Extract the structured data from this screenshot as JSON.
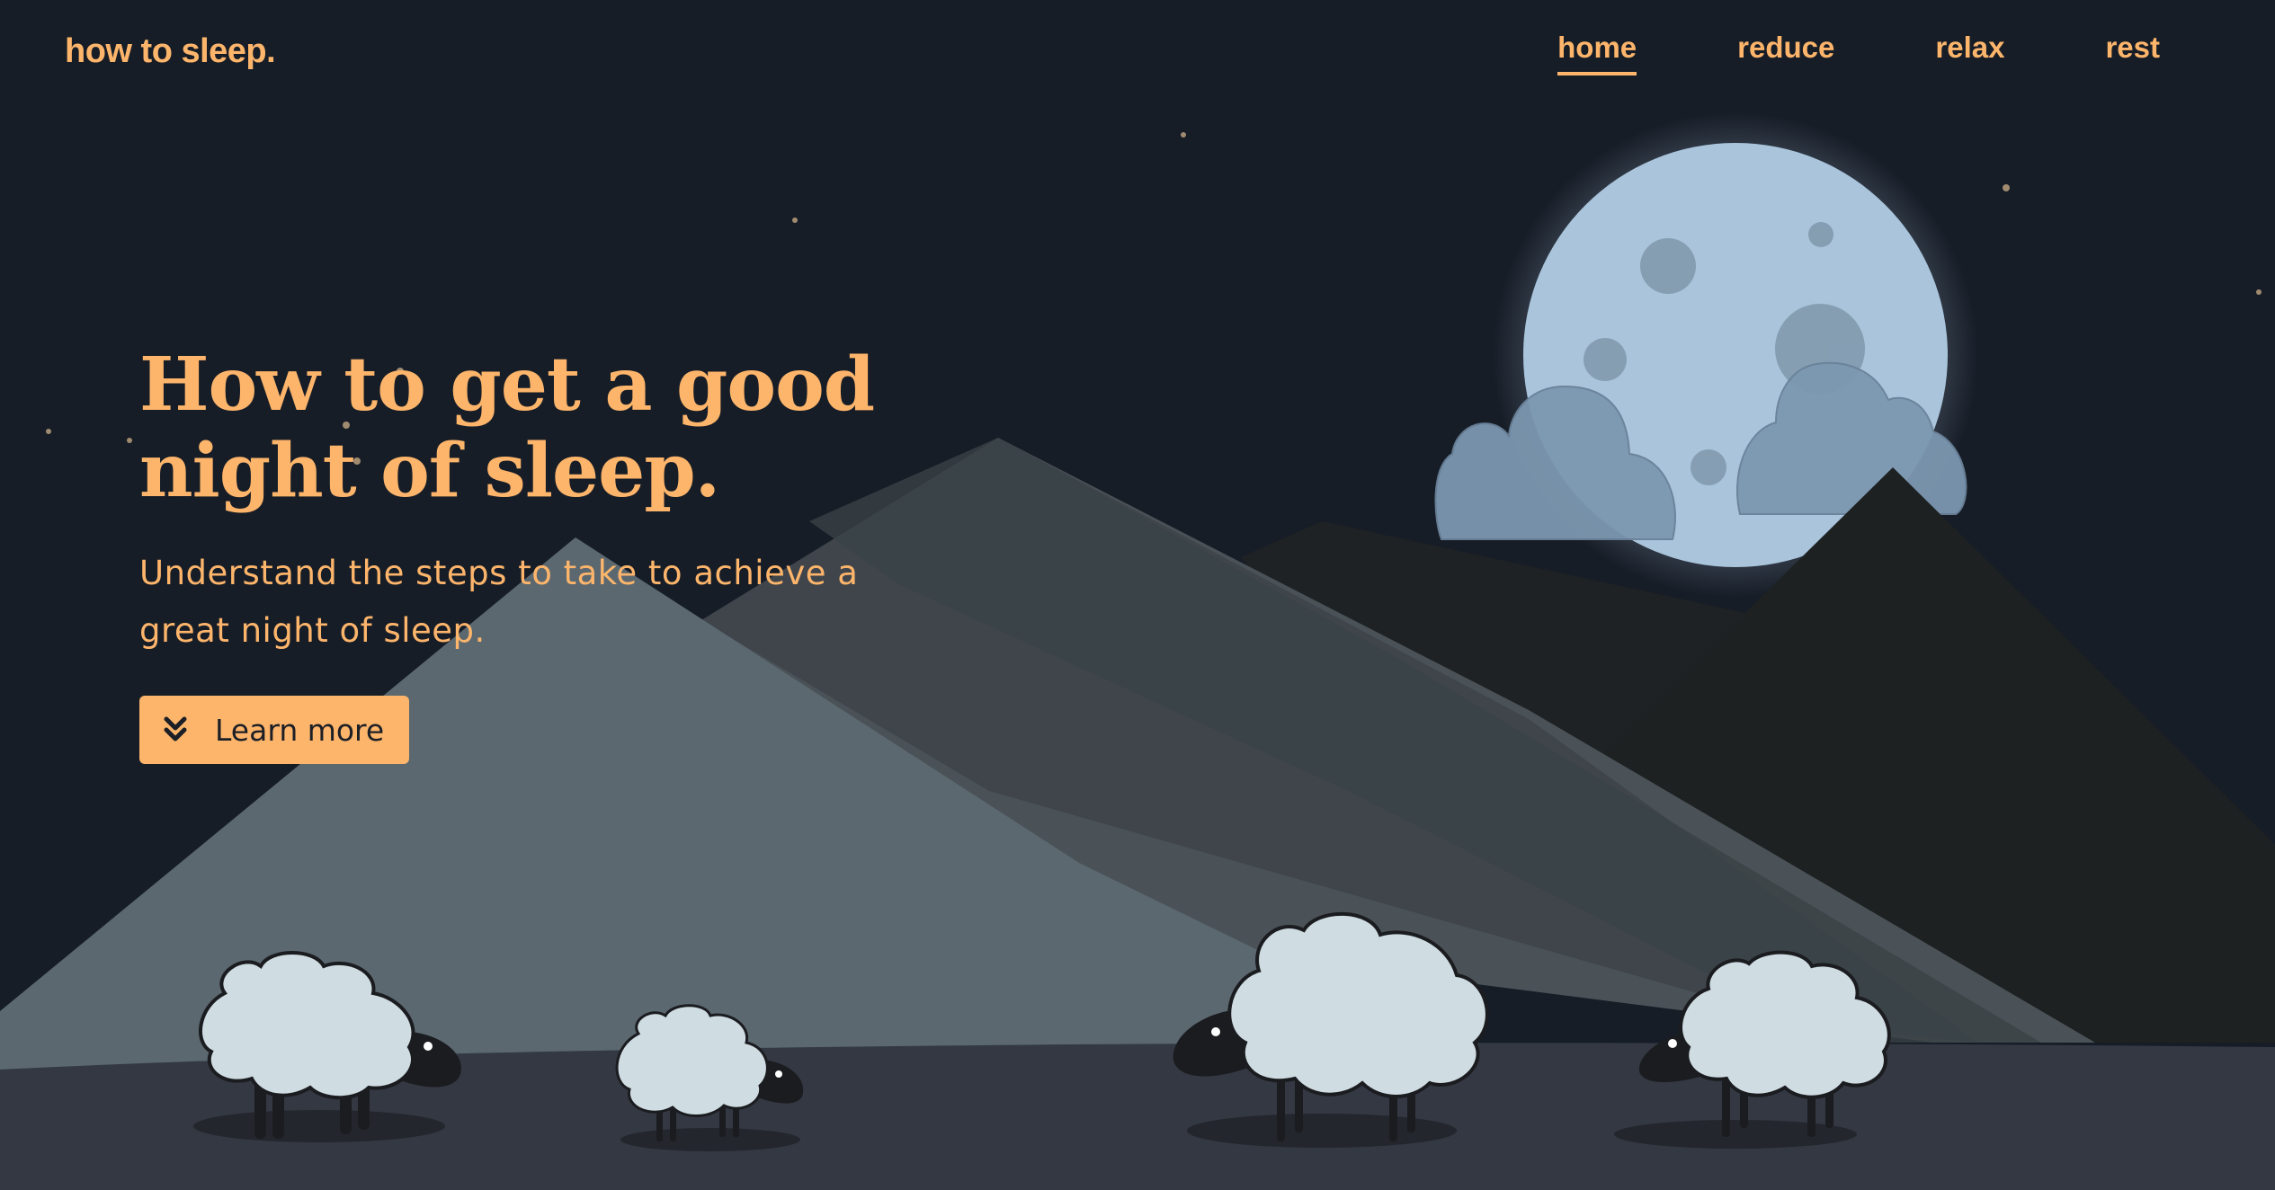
{
  "header": {
    "logo": "how to sleep.",
    "nav": [
      {
        "label": "home",
        "active": true
      },
      {
        "label": "reduce",
        "active": false
      },
      {
        "label": "relax",
        "active": false
      },
      {
        "label": "rest",
        "active": false
      }
    ]
  },
  "hero": {
    "title_line1": "How to get a good",
    "title_line2": "night of sleep.",
    "subtitle_line1": "Understand the steps to take to achieve a",
    "subtitle_line2": "great night of sleep.",
    "cta_label": "Learn more",
    "cta_icon": "double-chevron-down-icon"
  },
  "colors": {
    "sky": "#171d27",
    "accent": "#fdb56b",
    "moon": "#a9c4db",
    "ground": "#333842"
  }
}
